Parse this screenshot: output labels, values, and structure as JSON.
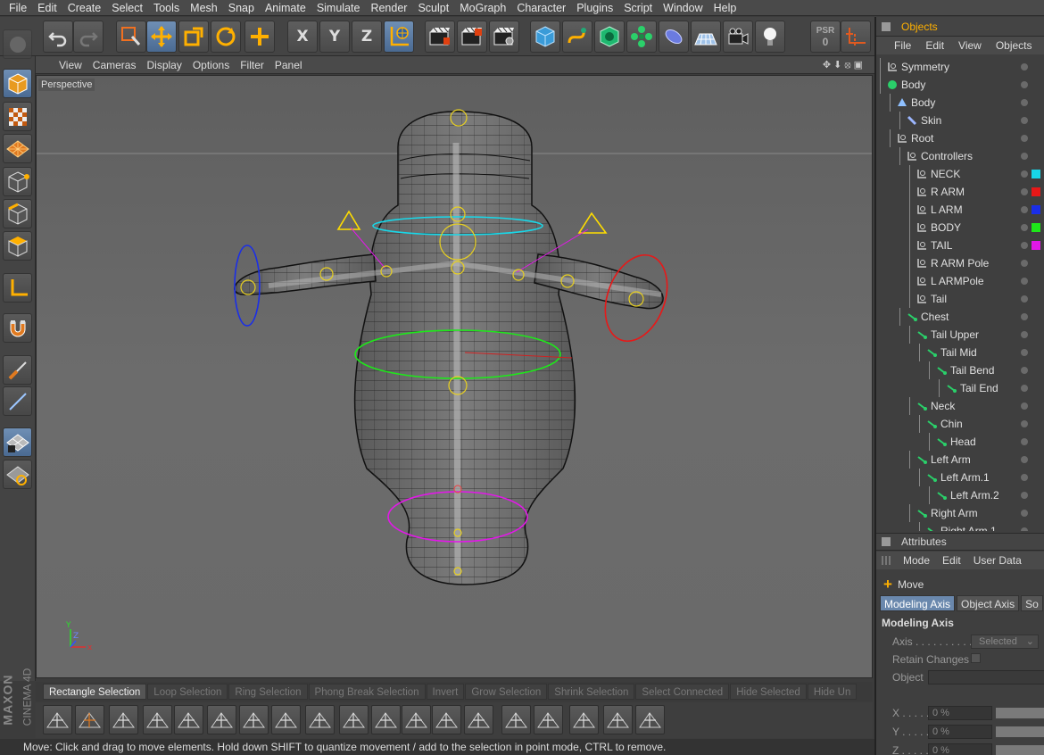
{
  "menu": [
    "File",
    "Edit",
    "Create",
    "Select",
    "Tools",
    "Mesh",
    "Snap",
    "Animate",
    "Simulate",
    "Render",
    "Sculpt",
    "MoGraph",
    "Character",
    "Plugins",
    "Script",
    "Window",
    "Help"
  ],
  "toolbar": {
    "axis_x": "X",
    "axis_y": "Y",
    "axis_z": "Z",
    "psr_label": "PSR",
    "psr_value": "0",
    "icons": [
      "undo-icon",
      "redo-icon",
      "live-selection-icon",
      "move-icon",
      "scale-icon",
      "rotate-icon",
      "add-icon",
      "x-axis-icon",
      "y-axis-icon",
      "z-axis-icon",
      "coordinate-system-icon",
      "render-view-icon",
      "render-picture-viewer-icon",
      "render-settings-icon",
      "cube-icon",
      "spline-pen-icon",
      "subdivision-surface-icon",
      "array-icon",
      "deformer-icon",
      "floor-icon",
      "camera-icon",
      "light-icon"
    ]
  },
  "viewport": {
    "menu": [
      "View",
      "Cameras",
      "Display",
      "Options",
      "Filter",
      "Panel"
    ],
    "label": "Perspective",
    "axis_letters": {
      "y": "Y",
      "z": "Z",
      "x": "x"
    }
  },
  "selection_bar": [
    "Rectangle Selection",
    "Loop Selection",
    "Ring Selection",
    "Phong Break Selection",
    "Invert",
    "Grow Selection",
    "Shrink Selection",
    "Select Connected",
    "Hide Selected",
    "Hide Un"
  ],
  "brand": {
    "maxon": "MAXON",
    "product": "CINEMA 4D"
  },
  "status": "Move: Click and drag to move elements. Hold down SHIFT to quantize movement / add to the selection in point mode, CTRL to remove.",
  "objects_panel": {
    "title": "Objects",
    "menu": [
      "File",
      "Edit",
      "View",
      "Objects"
    ],
    "items": [
      {
        "label": "Symmetry",
        "depth": 0,
        "kind": "null",
        "tag": ""
      },
      {
        "label": "Body",
        "depth": 0,
        "kind": "generator",
        "tag": ""
      },
      {
        "label": "Body",
        "depth": 1,
        "kind": "mesh",
        "tag": ""
      },
      {
        "label": "Skin",
        "depth": 2,
        "kind": "skin",
        "tag": ""
      },
      {
        "label": "Root",
        "depth": 1,
        "kind": "null",
        "tag": ""
      },
      {
        "label": "Controllers",
        "depth": 2,
        "kind": "null",
        "tag": ""
      },
      {
        "label": "NECK",
        "depth": 3,
        "kind": "null",
        "tag": "#18d7e8"
      },
      {
        "label": "R ARM",
        "depth": 3,
        "kind": "null",
        "tag": "#e81818"
      },
      {
        "label": "L ARM",
        "depth": 3,
        "kind": "null",
        "tag": "#1a2ee8"
      },
      {
        "label": "BODY",
        "depth": 3,
        "kind": "null",
        "tag": "#1ee81a"
      },
      {
        "label": "TAIL",
        "depth": 3,
        "kind": "null",
        "tag": "#e218e8"
      },
      {
        "label": "R ARM Pole",
        "depth": 3,
        "kind": "null",
        "tag": ""
      },
      {
        "label": "L ARMPole",
        "depth": 3,
        "kind": "null",
        "tag": ""
      },
      {
        "label": "Tail",
        "depth": 3,
        "kind": "null",
        "tag": ""
      },
      {
        "label": "Chest",
        "depth": 2,
        "kind": "joint",
        "tag": ""
      },
      {
        "label": "Tail Upper",
        "depth": 3,
        "kind": "joint",
        "tag": ""
      },
      {
        "label": "Tail Mid",
        "depth": 4,
        "kind": "joint",
        "tag": ""
      },
      {
        "label": "Tail Bend",
        "depth": 5,
        "kind": "joint",
        "tag": ""
      },
      {
        "label": "Tail End",
        "depth": 6,
        "kind": "joint",
        "tag": ""
      },
      {
        "label": "Neck",
        "depth": 3,
        "kind": "joint",
        "tag": ""
      },
      {
        "label": "Chin",
        "depth": 4,
        "kind": "joint",
        "tag": ""
      },
      {
        "label": "Head",
        "depth": 5,
        "kind": "joint",
        "tag": ""
      },
      {
        "label": "Left Arm",
        "depth": 3,
        "kind": "joint",
        "tag": ""
      },
      {
        "label": "Left Arm.1",
        "depth": 4,
        "kind": "joint",
        "tag": ""
      },
      {
        "label": "Left Arm.2",
        "depth": 5,
        "kind": "joint",
        "tag": ""
      },
      {
        "label": "Right Arm",
        "depth": 3,
        "kind": "joint",
        "tag": ""
      },
      {
        "label": "Right Arm.1",
        "depth": 4,
        "kind": "joint",
        "tag": ""
      }
    ]
  },
  "attributes_panel": {
    "title": "Attributes",
    "menu": [
      "Mode",
      "Edit",
      "User Data"
    ],
    "tool_name": "Move",
    "tabs": [
      "Modeling Axis",
      "Object Axis",
      "So"
    ],
    "section": "Modeling Axis",
    "axis_label": "Axis . . . . . . . . . . .",
    "axis_value": "Selected",
    "retain_label": "Retain Changes",
    "object_label": "Object",
    "coords": [
      {
        "label": "X . . . . .",
        "value": "0 %"
      },
      {
        "label": "Y . . . . .",
        "value": "0 %"
      },
      {
        "label": "Z . . . . .",
        "value": "0 %"
      }
    ]
  }
}
